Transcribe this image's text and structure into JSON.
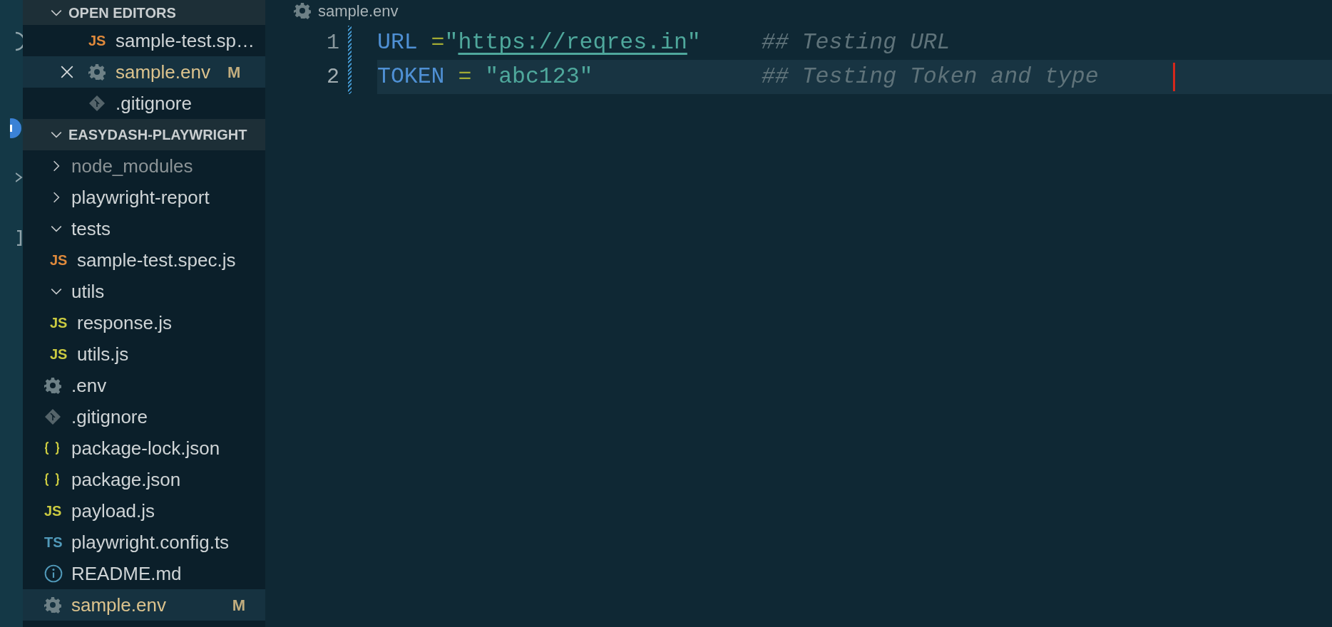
{
  "open_editors": {
    "title": "OPEN EDITORS",
    "expanded": true,
    "items": [
      {
        "kind": "script",
        "icon_text": "JS",
        "color": "#e08a3c",
        "name": "sample-test.sp…",
        "modified": false,
        "selected": false,
        "closable": false
      },
      {
        "kind": "settings",
        "name": "sample.env",
        "badge": "M",
        "modified": true,
        "selected": true,
        "closable": true
      },
      {
        "kind": "git",
        "name": ".gitignore",
        "modified": false,
        "selected": false,
        "closable": false
      }
    ]
  },
  "explorer": {
    "title": "EASYDASH-PLAYWRIGHT",
    "expanded": true,
    "items": [
      {
        "kind": "folder",
        "name": "node_modules",
        "expanded": false,
        "dimmed": true,
        "selected": false
      },
      {
        "kind": "folder",
        "name": "playwright-report",
        "expanded": false,
        "dimmed": false,
        "selected": false
      },
      {
        "kind": "folder",
        "name": "tests",
        "expanded": true,
        "dimmed": false,
        "selected": false,
        "children": [
          {
            "kind": "script",
            "icon_text": "JS",
            "color": "#e08a3c",
            "name": "sample-test.spec.js",
            "modified": false,
            "selected": false
          }
        ]
      },
      {
        "kind": "folder",
        "name": "utils",
        "expanded": true,
        "dimmed": false,
        "selected": false,
        "children": [
          {
            "kind": "script",
            "icon_text": "JS",
            "color": "#cbcb41",
            "name": "response.js",
            "modified": false,
            "selected": false
          },
          {
            "kind": "script",
            "icon_text": "JS",
            "color": "#cbcb41",
            "name": "utils.js",
            "modified": false,
            "selected": false
          }
        ]
      },
      {
        "kind": "settings",
        "name": ".env",
        "modified": false,
        "selected": false
      },
      {
        "kind": "git",
        "name": ".gitignore",
        "modified": false,
        "selected": false
      },
      {
        "kind": "json",
        "name": "package-lock.json",
        "modified": false,
        "selected": false
      },
      {
        "kind": "json",
        "name": "package.json",
        "modified": false,
        "selected": false
      },
      {
        "kind": "script",
        "icon_text": "JS",
        "color": "#cbcb41",
        "name": "payload.js",
        "modified": false,
        "selected": false
      },
      {
        "kind": "script",
        "icon_text": "TS",
        "color": "#519aba",
        "name": "playwright.config.ts",
        "modified": false,
        "selected": false
      },
      {
        "kind": "info",
        "name": "README.md",
        "modified": false,
        "selected": false
      },
      {
        "kind": "settings",
        "name": "sample.env",
        "badge": "M",
        "modified": true,
        "selected": true
      }
    ]
  },
  "editor": {
    "breadcrumb": "sample.env",
    "lines": [
      {
        "number": "1",
        "active": false,
        "code": [
          {
            "kind": "key",
            "text": "URL"
          },
          {
            "kind": "operator",
            "text": " ="
          },
          {
            "kind": "string",
            "text": "\""
          },
          {
            "kind": "link",
            "text": "https://reqres.in"
          },
          {
            "kind": "string",
            "text": "\""
          }
        ],
        "comment": "## Testing URL"
      },
      {
        "number": "2",
        "active": true,
        "code": [
          {
            "kind": "key",
            "text": "TOKEN"
          },
          {
            "kind": "operator",
            "text": " = "
          },
          {
            "kind": "string",
            "text": "\"abc123\""
          }
        ],
        "comment": "## Testing Token and type"
      }
    ]
  }
}
